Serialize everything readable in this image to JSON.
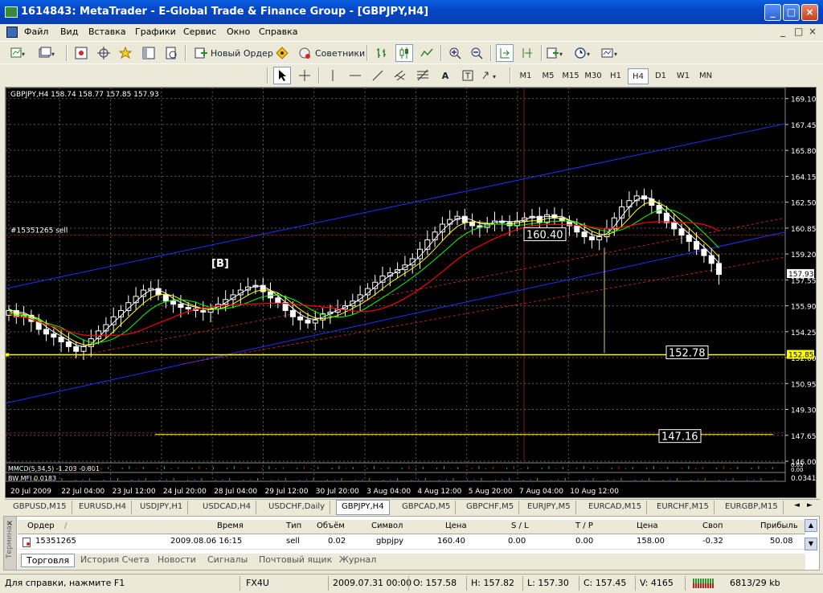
{
  "window": {
    "title": "1614843: MetaTrader - E-Global Trade & Finance Group - [GBPJPY,H4]",
    "minimize": "_",
    "maximize": "□",
    "close": "×"
  },
  "menu": {
    "items": [
      "Файл",
      "Вид",
      "Вставка",
      "Графики",
      "Сервис",
      "Окно",
      "Справка"
    ],
    "mdi_controls": [
      "_",
      "□",
      "×"
    ]
  },
  "toolbar": {
    "new_order_label": "Новый Ордер",
    "experts_label": "Советники",
    "text_tool": "A",
    "timeframes": [
      "M1",
      "M5",
      "M15",
      "M30",
      "H1",
      "H4",
      "D1",
      "W1",
      "MN"
    ],
    "active_timeframe": "H4"
  },
  "chart": {
    "header": "GBPJPY,H4  158.74 158.77 157.85 157.93",
    "order_label": "#15351265 sell",
    "trade_marker": "[B]",
    "label_160": "160.40",
    "label_152": "152.78",
    "label_147": "147.16",
    "current_price": "157.93",
    "hline_price": "152.85",
    "indicator1_label": "MMCD(5,34,5) -1.203 -0.801",
    "indicator2_label": "BW MFI 0.0183",
    "ind1_values": [
      "0.65",
      "0.00"
    ],
    "ind2_value": "0.0341",
    "colors": {
      "background": "#000000",
      "grid": "#5a5a5a",
      "candle": "#ffffff",
      "candle_up_body": "#000000",
      "ma_white": "#ffffff",
      "ma_yellow": "#ffff00",
      "ma_green": "#00ff00",
      "ma_red": "#ff0000",
      "channel": "#2030ff",
      "level_line": "#ffff00"
    }
  },
  "chart_data": {
    "type": "candlestick",
    "symbol": "GBPJPY",
    "timeframe": "H4",
    "y_ticks": [
      "169.10",
      "167.45",
      "165.80",
      "164.15",
      "162.50",
      "160.85",
      "159.20",
      "157.55",
      "155.90",
      "154.25",
      "152.60",
      "150.95",
      "149.30",
      "147.65",
      "146.00"
    ],
    "ylim": [
      146.0,
      169.8
    ],
    "x_ticks": [
      "20 Jul 2009",
      "22 Jul 04:00",
      "23 Jul 12:00",
      "24 Jul 20:00",
      "28 Jul 04:00",
      "29 Jul 12:00",
      "30 Jul 20:00",
      "3 Aug 04:00",
      "4 Aug 12:00",
      "5 Aug 20:00",
      "7 Aug 04:00",
      "10 Aug 12:00"
    ],
    "closes": [
      155.6,
      155.2,
      155.3,
      154.9,
      154.4,
      154.1,
      153.9,
      153.6,
      153.3,
      153.0,
      153.3,
      153.8,
      154.3,
      154.7,
      155.2,
      155.6,
      156.1,
      156.5,
      156.9,
      157.0,
      156.6,
      156.2,
      156.0,
      155.8,
      155.7,
      155.6,
      155.5,
      155.7,
      156.0,
      156.3,
      156.6,
      156.9,
      157.1,
      157.2,
      156.8,
      156.4,
      156.1,
      155.6,
      155.2,
      155.0,
      154.8,
      155.0,
      155.4,
      155.5,
      155.7,
      155.9,
      156.2,
      156.6,
      157.0,
      157.4,
      157.8,
      158.0,
      158.2,
      158.5,
      158.9,
      159.5,
      160.1,
      160.6,
      161.1,
      161.4,
      161.6,
      161.2,
      161.0,
      160.9,
      161.1,
      161.3,
      161.2,
      161.0,
      161.3,
      161.5,
      161.6,
      161.2,
      161.7,
      161.5,
      161.3,
      161.0,
      160.6,
      160.3,
      160.1,
      160.3,
      160.8,
      161.5,
      162.2,
      162.6,
      162.9,
      162.7,
      162.3,
      161.8,
      161.2,
      160.8,
      160.4,
      160.0,
      159.5,
      159.1,
      158.6,
      157.9
    ],
    "trade_levels": {
      "order_price": 160.4,
      "level_152": 152.78,
      "level_147": 147.16,
      "current": 157.93
    }
  },
  "symbol_tabs": [
    "GBPUSD,M15",
    "EURUSD,H4",
    "USDJPY,H1",
    "USDCAD,H4",
    "USDCHF,Daily",
    "GBPJPY,H4",
    "GBPCAD,M5",
    "GBPCHF,M5",
    "EURJPY,M5",
    "EURCAD,M15",
    "EURCHF,M15",
    "EURGBP,M15"
  ],
  "active_symbol_tab": "GBPJPY,H4",
  "terminal": {
    "side_label": "Терминал",
    "columns": [
      "Ордер",
      "/",
      "Время",
      "Тип",
      "Объём",
      "Символ",
      "Цена",
      "S / L",
      "T / P",
      "Цена",
      "Своп",
      "Прибыль"
    ],
    "row": [
      "15351265",
      "2009.08.06 16:15",
      "sell",
      "0.02",
      "gbpjpy",
      "160.40",
      "0.00",
      "0.00",
      "158.00",
      "-0.32",
      "50.08"
    ],
    "tabs": [
      "Торговля",
      "История Счета",
      "Новости",
      "Сигналы",
      "Почтовый ящик",
      "Журнал"
    ],
    "active_tab": "Торговля"
  },
  "status": {
    "help": "Для справки, нажмите F1",
    "profile": "FX4U",
    "datetime": "2009.07.31 00:00",
    "open": "O: 157.58",
    "high": "H: 157.82",
    "low": "L: 157.30",
    "close": "C: 157.45",
    "volume": "V: 4165",
    "traffic": "6813/29 kb"
  }
}
